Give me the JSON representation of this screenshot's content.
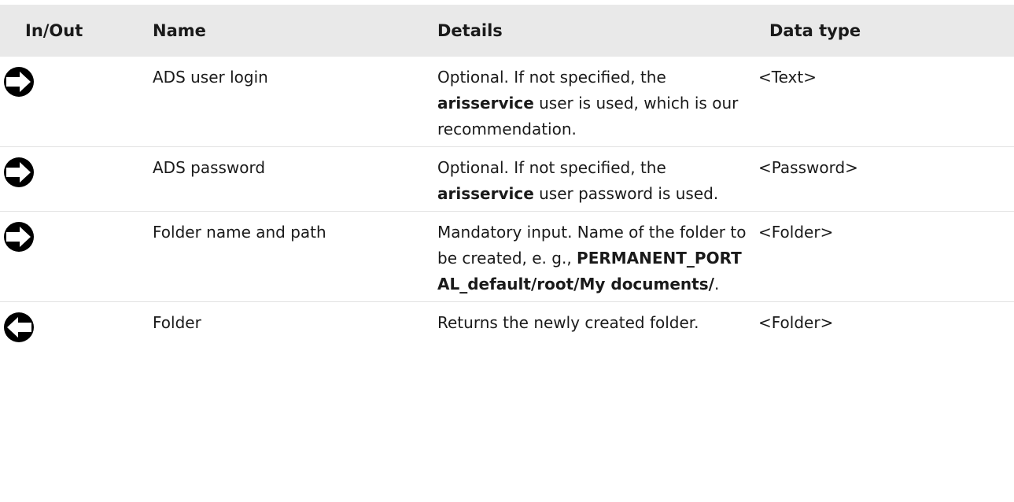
{
  "table": {
    "headers": [
      "In/Out",
      "Name",
      "Details",
      "Data type"
    ],
    "rows": [
      {
        "direction": "input-arrow-icon",
        "name": "ADS user login",
        "details_pre": "Optional. If not specified, the",
        "details_bold": "arisservice",
        "details_post": " user is used, which is our recommendation.",
        "data_type": "<Text>"
      },
      {
        "direction": "input-arrow-icon",
        "name": "ADS password",
        "details_pre": "Optional. If not specified, the",
        "details_bold": "arisservice",
        "details_post": " user password is used.",
        "data_type": "<Password>"
      },
      {
        "direction": "input-arrow-icon",
        "name": "Folder name and path",
        "details_pre": "Mandatory input. Name of the folder to be created, e. g.,",
        "details_bold": "PERMANENT_PORTAL_default/root/My documents/",
        "details_post": ".",
        "data_type": "<Folder>"
      },
      {
        "direction": "output-arrow-icon",
        "name": "Folder",
        "details_pre": "Returns the newly created folder.",
        "details_bold": "",
        "details_post": "",
        "data_type": "<Folder>"
      }
    ]
  }
}
